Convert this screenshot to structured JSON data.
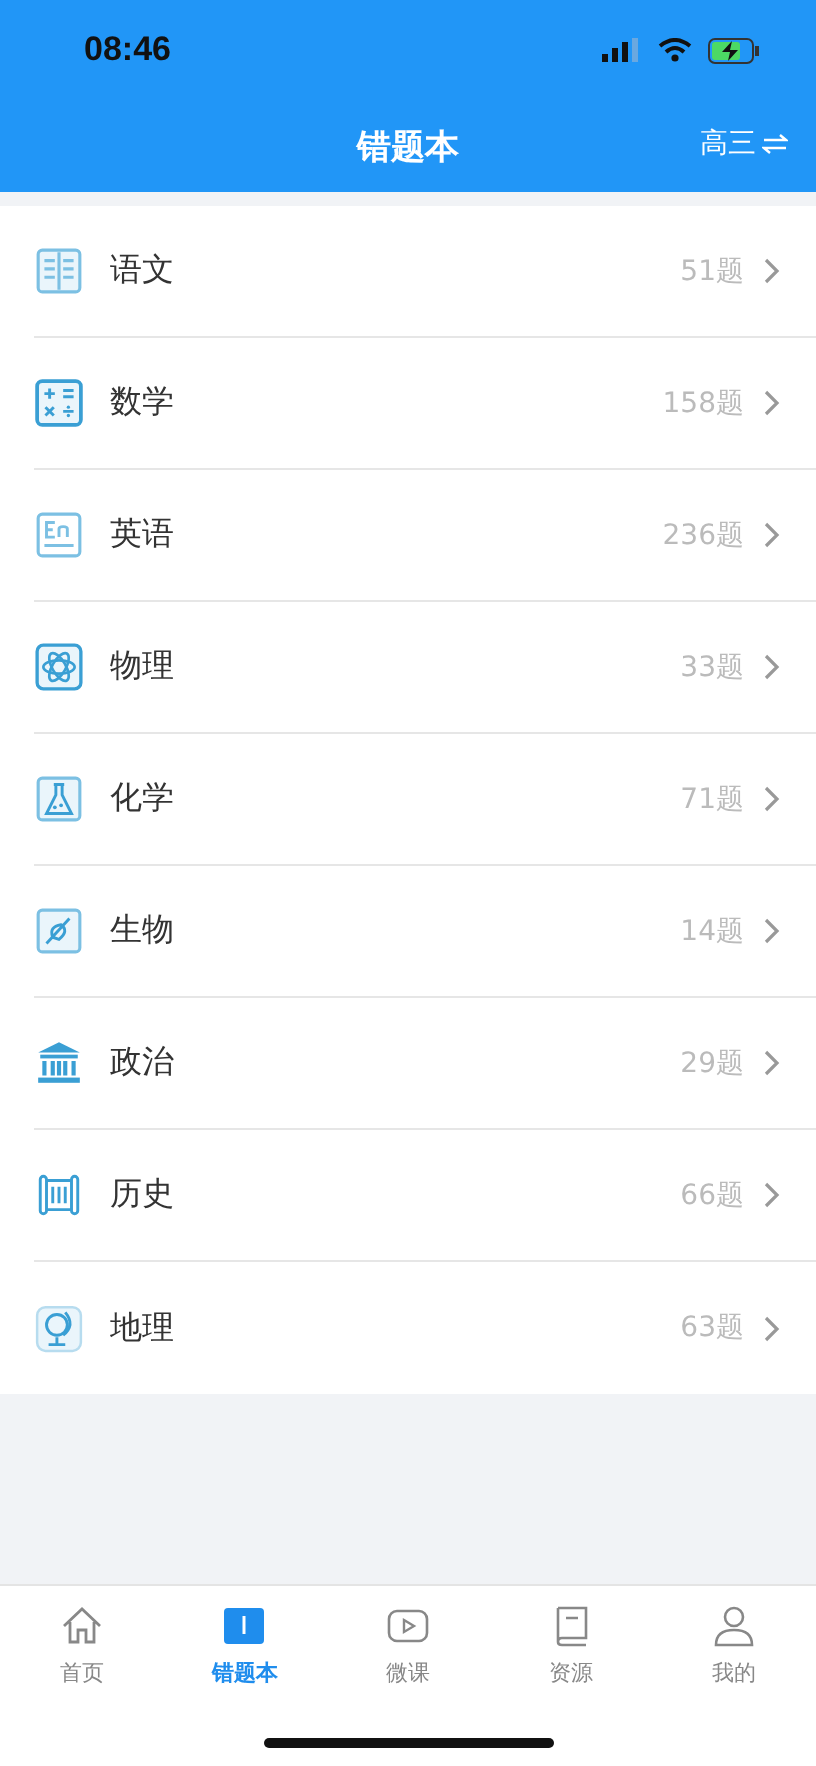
{
  "status_bar": {
    "time": "08:46"
  },
  "header": {
    "title": "错题本",
    "grade": "高三"
  },
  "subjects": [
    {
      "name": "语文",
      "count": "51题"
    },
    {
      "name": "数学",
      "count": "158题"
    },
    {
      "name": "英语",
      "count": "236题"
    },
    {
      "name": "物理",
      "count": "33题"
    },
    {
      "name": "化学",
      "count": "71题"
    },
    {
      "name": "生物",
      "count": "14题"
    },
    {
      "name": "政治",
      "count": "29题"
    },
    {
      "name": "历史",
      "count": "66题"
    },
    {
      "name": "地理",
      "count": "63题"
    }
  ],
  "tab_bar": [
    {
      "label": "首页",
      "selected": false
    },
    {
      "label": "错题本",
      "selected": true
    },
    {
      "label": "微课",
      "selected": false
    },
    {
      "label": "资源",
      "selected": false
    },
    {
      "label": "我的",
      "selected": false
    }
  ]
}
